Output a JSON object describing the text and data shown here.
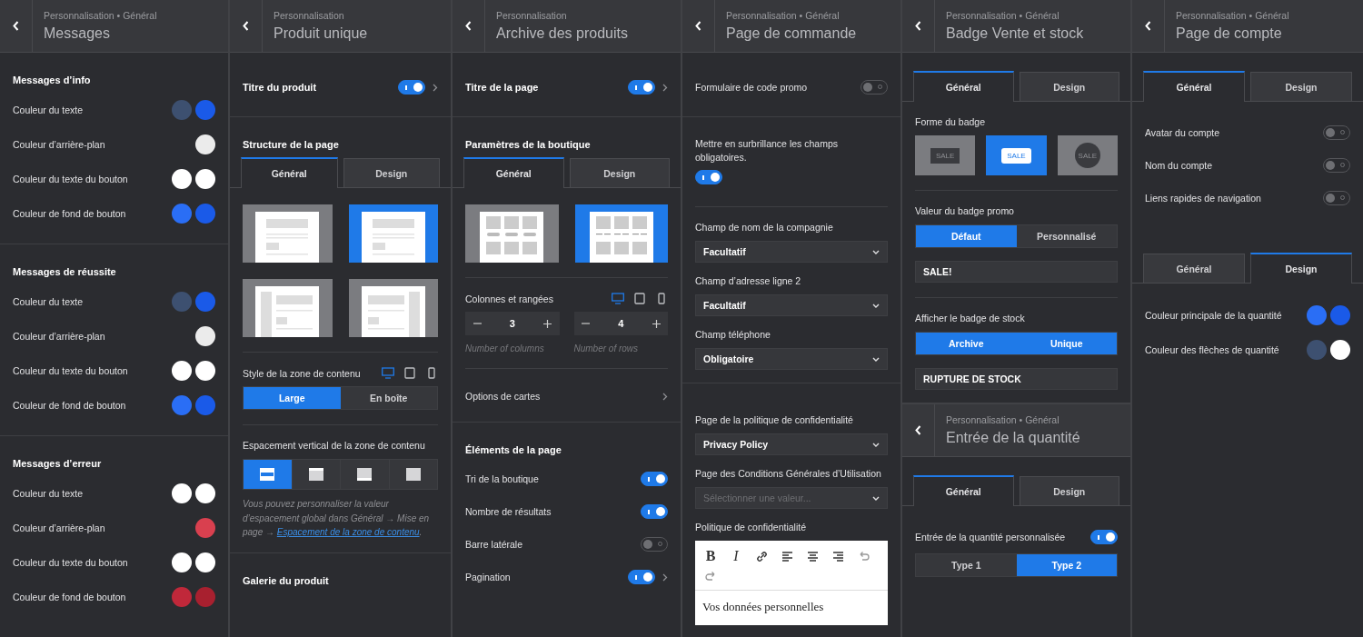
{
  "columns": [
    {
      "panels": [
        {
          "breadcrumb": "Personnalisation • Général",
          "title": "Messages",
          "sections": [
            {
              "items": [
                {
                  "kind": "heading",
                  "label": "Messages d’info"
                },
                {
                  "kind": "color",
                  "label": "Couleur du texte",
                  "swatches": [
                    {
                      "color": "#3d5070"
                    },
                    {
                      "color": "#1a5ae8"
                    }
                  ]
                },
                {
                  "kind": "color",
                  "label": "Couleur d’arrière-plan",
                  "swatches": [
                    {
                      "color": "#ebebeb"
                    }
                  ]
                },
                {
                  "kind": "color",
                  "label": "Couleur du texte du bouton",
                  "swatches": [
                    {
                      "color": "#ffffff"
                    },
                    {
                      "color": "#ffffff"
                    }
                  ]
                },
                {
                  "kind": "color",
                  "label": "Couleur de fond de bouton",
                  "swatches": [
                    {
                      "color": "#2a6ef5"
                    },
                    {
                      "color": "#1a5ae8"
                    }
                  ]
                }
              ]
            },
            {
              "items": [
                {
                  "kind": "heading",
                  "label": "Messages de réussite"
                },
                {
                  "kind": "color",
                  "label": "Couleur du texte",
                  "swatches": [
                    {
                      "color": "#3d5070"
                    },
                    {
                      "color": "#1a5ae8"
                    }
                  ]
                },
                {
                  "kind": "color",
                  "label": "Couleur d’arrière-plan",
                  "swatches": [
                    {
                      "color": "#ebebeb"
                    }
                  ]
                },
                {
                  "kind": "color",
                  "label": "Couleur du texte du bouton",
                  "swatches": [
                    {
                      "color": "#ffffff"
                    },
                    {
                      "color": "#ffffff"
                    }
                  ]
                },
                {
                  "kind": "color",
                  "label": "Couleur de fond de bouton",
                  "swatches": [
                    {
                      "color": "#2a6ef5"
                    },
                    {
                      "color": "#1a5ae8"
                    }
                  ]
                }
              ]
            },
            {
              "items": [
                {
                  "kind": "heading",
                  "label": "Messages d’erreur"
                },
                {
                  "kind": "color",
                  "label": "Couleur du texte",
                  "swatches": [
                    {
                      "color": "#ffffff"
                    },
                    {
                      "color": "#ffffff"
                    }
                  ]
                },
                {
                  "kind": "color",
                  "label": "Couleur d’arrière-plan",
                  "swatches": [
                    {
                      "color": "#d9404f"
                    }
                  ]
                },
                {
                  "kind": "color",
                  "label": "Couleur du texte du bouton",
                  "swatches": [
                    {
                      "color": "#ffffff"
                    },
                    {
                      "color": "#ffffff"
                    }
                  ]
                },
                {
                  "kind": "color",
                  "label": "Couleur de fond de bouton",
                  "swatches": [
                    {
                      "color": "#c0283a"
                    },
                    {
                      "color": "#a8202f"
                    }
                  ]
                }
              ]
            }
          ]
        }
      ]
    },
    {
      "panels": [
        {
          "breadcrumb": "Personnalisation",
          "title": "Produit unique",
          "sections": [
            {
              "items": [
                {
                  "kind": "title_toggle",
                  "label": "Titre du produit",
                  "on": true,
                  "chevron": true
                }
              ]
            },
            {
              "items": [
                {
                  "kind": "heading",
                  "label": "Structure de la page"
                },
                {
                  "kind": "tabs",
                  "tabs": [
                    {
                      "label": "Général",
                      "selected": true
                    },
                    {
                      "label": "Design",
                      "selected": false
                    }
                  ]
                },
                {
                  "kind": "layouts",
                  "options": [
                    {
                      "kind": "full",
                      "selected": false
                    },
                    {
                      "kind": "full",
                      "selected": true
                    },
                    {
                      "kind": "left-sidebar",
                      "selected": false
                    },
                    {
                      "kind": "right-sidebar",
                      "selected": false
                    }
                  ]
                },
                {
                  "kind": "divider"
                },
                {
                  "kind": "devices",
                  "label": "Style de la zone de contenu",
                  "devices": [
                    {
                      "kind": "desktop",
                      "selected": true
                    },
                    {
                      "kind": "tablet",
                      "selected": false
                    },
                    {
                      "kind": "mobile",
                      "selected": false
                    }
                  ]
                },
                {
                  "kind": "segmented",
                  "options": [
                    {
                      "label": "Large",
                      "selected": true
                    },
                    {
                      "label": "En boîte",
                      "selected": false
                    }
                  ]
                },
                {
                  "kind": "divider"
                },
                {
                  "kind": "label",
                  "label": "Espacement vertical de la zone de contenu"
                },
                {
                  "kind": "spacing",
                  "options": [
                    {
                      "kind": "both",
                      "selected": true
                    },
                    {
                      "kind": "top",
                      "selected": false
                    },
                    {
                      "kind": "bottom",
                      "selected": false
                    },
                    {
                      "kind": "none",
                      "selected": false
                    }
                  ]
                },
                {
                  "kind": "note",
                  "text": "Vous pouvez personnaliser la valeur d’espacement global dans Général → Mise en page → ",
                  "link": "Espacement de la zone de contenu",
                  "after": "."
                }
              ]
            },
            {
              "items": [
                {
                  "kind": "heading",
                  "label": "Galerie du produit"
                }
              ]
            }
          ]
        }
      ]
    },
    {
      "panels": [
        {
          "breadcrumb": "Personnalisation",
          "title": "Archive des produits",
          "sections": [
            {
              "items": [
                {
                  "kind": "title_toggle",
                  "label": "Titre de la page",
                  "on": true,
                  "chevron": true
                }
              ]
            },
            {
              "items": [
                {
                  "kind": "heading",
                  "label": "Paramètres de la boutique"
                },
                {
                  "kind": "tabs",
                  "tabs": [
                    {
                      "label": "Général",
                      "selected": true
                    },
                    {
                      "label": "Design",
                      "selected": false
                    }
                  ]
                },
                {
                  "kind": "layouts",
                  "options": [
                    {
                      "kind": "grid-buttons",
                      "selected": false
                    },
                    {
                      "kind": "grid-lines",
                      "selected": true
                    }
                  ]
                },
                {
                  "kind": "divider"
                },
                {
                  "kind": "devices",
                  "label": "Colonnes et rangées",
                  "devices": [
                    {
                      "kind": "desktop",
                      "selected": true
                    },
                    {
                      "kind": "tablet",
                      "selected": false
                    },
                    {
                      "kind": "mobile",
                      "selected": false
                    }
                  ]
                },
                {
                  "kind": "steppers",
                  "steppers": [
                    {
                      "value": "3",
                      "caption": "Number of columns"
                    },
                    {
                      "value": "4",
                      "caption": "Number of rows"
                    }
                  ]
                },
                {
                  "kind": "divider"
                },
                {
                  "kind": "link",
                  "label": "Options de cartes"
                }
              ]
            },
            {
              "items": [
                {
                  "kind": "heading",
                  "label": "Éléments de la page"
                },
                {
                  "kind": "toggle",
                  "label": "Tri de la boutique",
                  "on": true
                },
                {
                  "kind": "toggle",
                  "label": "Nombre de résultats",
                  "on": true
                },
                {
                  "kind": "toggle",
                  "label": "Barre latérale",
                  "on": false
                },
                {
                  "kind": "toggle",
                  "label": "Pagination",
                  "on": true,
                  "chevron": true
                }
              ]
            }
          ]
        }
      ]
    },
    {
      "panels": [
        {
          "breadcrumb": "Personnalisation • Général",
          "title": "Page de commande",
          "sections": [
            {
              "items": [
                {
                  "kind": "toggle",
                  "label": "Formulaire de code promo",
                  "on": false
                }
              ]
            },
            {
              "items": [
                {
                  "kind": "toggle_stacked",
                  "label": "Mettre en surbrillance les champs obligatoires.",
                  "on": true
                },
                {
                  "kind": "divider"
                },
                {
                  "kind": "select",
                  "label": "Champ de nom de la compagnie",
                  "value": "Facultatif"
                },
                {
                  "kind": "select",
                  "label": "Champ d’adresse ligne 2",
                  "value": "Facultatif"
                },
                {
                  "kind": "select",
                  "label": "Champ téléphone",
                  "value": "Obligatoire"
                }
              ]
            },
            {
              "items": [
                {
                  "kind": "select",
                  "label": "Page de la politique de confidentialité",
                  "value": "Privacy Policy"
                },
                {
                  "kind": "select",
                  "label": "Page des Conditions Générales d’Utilisation",
                  "placeholder": "Sélectionner une valeur..."
                },
                {
                  "kind": "editor",
                  "label": "Politique de confidentialité",
                  "toolbar": [
                    {
                      "kind": "bold",
                      "label": "B"
                    },
                    {
                      "kind": "italic",
                      "label": "I"
                    },
                    {
                      "kind": "link"
                    },
                    {
                      "kind": "align-left"
                    },
                    {
                      "kind": "align-center"
                    },
                    {
                      "kind": "align-right"
                    },
                    {
                      "kind": "undo"
                    },
                    {
                      "kind": "redo"
                    }
                  ],
                  "content": "Vos données personnelles"
                }
              ]
            }
          ]
        }
      ]
    },
    {
      "panels": [
        {
          "breadcrumb": "Personnalisation • Général",
          "title": "Badge Vente et stock",
          "sections": [
            {
              "items": [
                {
                  "kind": "tabs",
                  "tabs": [
                    {
                      "label": "Général",
                      "selected": true
                    },
                    {
                      "label": "Design",
                      "selected": false
                    }
                  ]
                },
                {
                  "kind": "label",
                  "label": "Forme du badge"
                },
                {
                  "kind": "badges",
                  "options": [
                    {
                      "kind": "square",
                      "label": "SALE",
                      "selected": false
                    },
                    {
                      "kind": "rounded",
                      "label": "SALE",
                      "selected": true
                    },
                    {
                      "kind": "circle",
                      "label": "SALE",
                      "selected": false
                    }
                  ]
                },
                {
                  "kind": "divider"
                },
                {
                  "kind": "label",
                  "label": "Valeur du badge promo"
                },
                {
                  "kind": "segmented",
                  "options": [
                    {
                      "label": "Défaut",
                      "selected": true
                    },
                    {
                      "label": "Personnalisé",
                      "selected": false
                    }
                  ]
                },
                {
                  "kind": "field",
                  "value": "SALE!"
                },
                {
                  "kind": "divider"
                },
                {
                  "kind": "label",
                  "label": "Afficher le badge de stock"
                },
                {
                  "kind": "segmented",
                  "options": [
                    {
                      "label": "Archive",
                      "selected": true
                    },
                    {
                      "label": "Unique",
                      "selected": true
                    }
                  ]
                },
                {
                  "kind": "field",
                  "value": "RUPTURE DE STOCK"
                }
              ]
            }
          ]
        },
        {
          "breadcrumb": "Personnalisation • Général",
          "title": "Entrée de la quantité",
          "sections": [
            {
              "items": [
                {
                  "kind": "tabs",
                  "tabs": [
                    {
                      "label": "Général",
                      "selected": true
                    },
                    {
                      "label": "Design",
                      "selected": false
                    }
                  ]
                },
                {
                  "kind": "toggle",
                  "label": "Entrée de la quantité personnalisée",
                  "on": true
                },
                {
                  "kind": "segmented",
                  "options": [
                    {
                      "label": "Type 1",
                      "selected": false
                    },
                    {
                      "label": "Type 2",
                      "selected": true
                    }
                  ]
                }
              ]
            }
          ]
        }
      ]
    },
    {
      "panels": [
        {
          "breadcrumb": "Personnalisation • Général",
          "title": "Page de compte",
          "sections": [
            {
              "items": [
                {
                  "kind": "tabs",
                  "tabs": [
                    {
                      "label": "Général",
                      "selected": true
                    },
                    {
                      "label": "Design",
                      "selected": false
                    }
                  ]
                },
                {
                  "kind": "toggle",
                  "label": "Avatar du compte",
                  "on": false
                },
                {
                  "kind": "toggle",
                  "label": "Nom du compte",
                  "on": false
                },
                {
                  "kind": "toggle",
                  "label": "Liens rapides de navigation",
                  "on": false
                },
                {
                  "kind": "tabs",
                  "tabs": [
                    {
                      "label": "Général",
                      "selected": false
                    },
                    {
                      "label": "Design",
                      "selected": true
                    }
                  ]
                },
                {
                  "kind": "color",
                  "label": "Couleur principale de la quantité",
                  "swatches": [
                    {
                      "color": "#2a6ef5"
                    },
                    {
                      "color": "#1a5ae8"
                    }
                  ]
                },
                {
                  "kind": "color",
                  "label": "Couleur des flèches de quantité",
                  "swatches": [
                    {
                      "color": "#3d5070"
                    },
                    {
                      "color": "#ffffff"
                    }
                  ]
                }
              ]
            }
          ]
        }
      ]
    }
  ]
}
